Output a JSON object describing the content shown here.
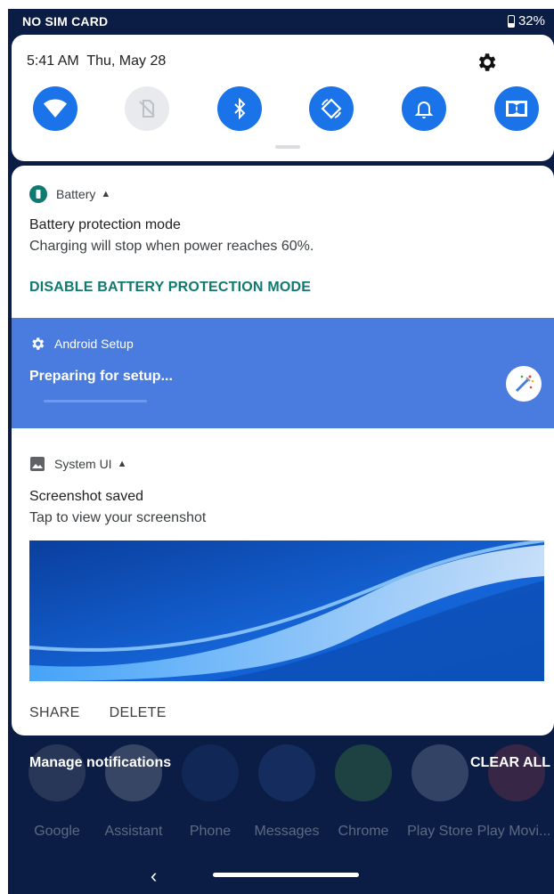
{
  "status_bar": {
    "carrier": "NO SIM CARD",
    "battery": "32%"
  },
  "quick_settings": {
    "time": "5:41 AM",
    "date": "Thu, May 28",
    "tiles": [
      {
        "icon": "wifi-icon",
        "active": true
      },
      {
        "icon": "no-sim-icon",
        "active": false
      },
      {
        "icon": "bluetooth-icon",
        "active": true
      },
      {
        "icon": "auto-rotate-icon",
        "active": true
      },
      {
        "icon": "notification-bell-icon",
        "active": true
      },
      {
        "icon": "dolby-icon",
        "active": true
      }
    ]
  },
  "notifications": {
    "battery": {
      "app": "Battery",
      "title": "Battery protection mode",
      "body": "Charging will stop when power reaches 60%.",
      "action": "DISABLE BATTERY PROTECTION MODE"
    },
    "setup": {
      "app": "Android Setup",
      "title": "Preparing for setup..."
    },
    "system_ui": {
      "app": "System UI",
      "title": "Screenshot saved",
      "body": "Tap to view your screenshot",
      "actions": [
        "SHARE",
        "DELETE"
      ]
    }
  },
  "footer": {
    "manage": "Manage notifications",
    "clear_all": "CLEAR ALL"
  },
  "home_dock": {
    "apps": [
      "Google",
      "Assistant",
      "Phone",
      "Messages",
      "Chrome",
      "Play Store",
      "Play Movi..."
    ]
  },
  "colors": {
    "accent": "#1a73e8",
    "setup_bg": "#4a7cdf",
    "action_teal": "#0f7a70",
    "scrim": "#0b1d44"
  }
}
